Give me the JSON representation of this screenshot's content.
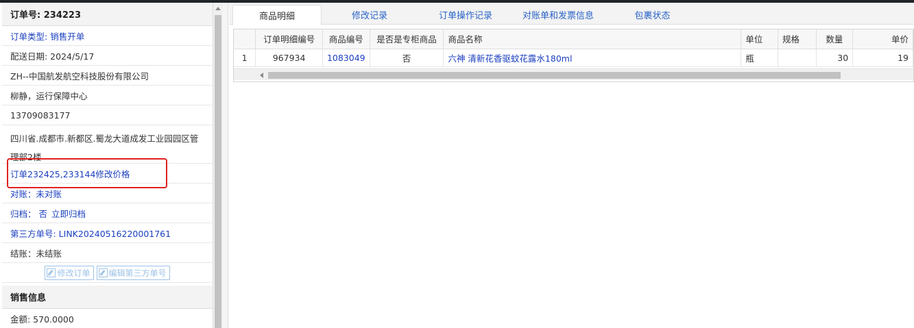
{
  "order": {
    "header": "订单号: 234223",
    "type_label": "订单类型:",
    "type_value": "销售开单",
    "ship_date": "配送日期: 2024/5/17",
    "company": "ZH--中国航发航空科技股份有限公司",
    "contact": "柳静，运行保障中心",
    "phone": "13709083177",
    "address": "四川省.成都市.新都区.蜀龙大道成发工业园园区管理部2楼",
    "remark": "订单232425,233144修改价格",
    "reconcile": "对账：未对账",
    "archive_label": "归档：",
    "archive_value": "否",
    "archive_link": "立即归档",
    "third_party": "第三方单号: LINK20240516220001761",
    "settle": "结账：未结账",
    "btn_edit_order": "修改订单",
    "btn_edit_third": "编辑第三方单号"
  },
  "sales": {
    "header": "销售信息",
    "amount": "金额: 570.0000"
  },
  "tabs": [
    {
      "label": "商品明细"
    },
    {
      "label": "修改记录"
    },
    {
      "label": "订单操作记录"
    },
    {
      "label": "对账单和发票信息"
    },
    {
      "label": "包裹状态"
    }
  ],
  "table": {
    "columns": [
      "",
      "订单明细编号",
      "商品编号",
      "是否是专柜商品",
      "商品名称",
      "单位",
      "规格",
      "数量",
      "单价"
    ],
    "rows": [
      [
        "1",
        "967934",
        "1083049",
        "否",
        "六神 清新花香驱蚊花露水180ml",
        "瓶",
        "",
        "30",
        "19"
      ]
    ]
  },
  "colors": {
    "link": "#1a3fbf",
    "tab_link": "#2a63c8",
    "annotation": "#e02020",
    "button_border": "#9fc3e7"
  }
}
